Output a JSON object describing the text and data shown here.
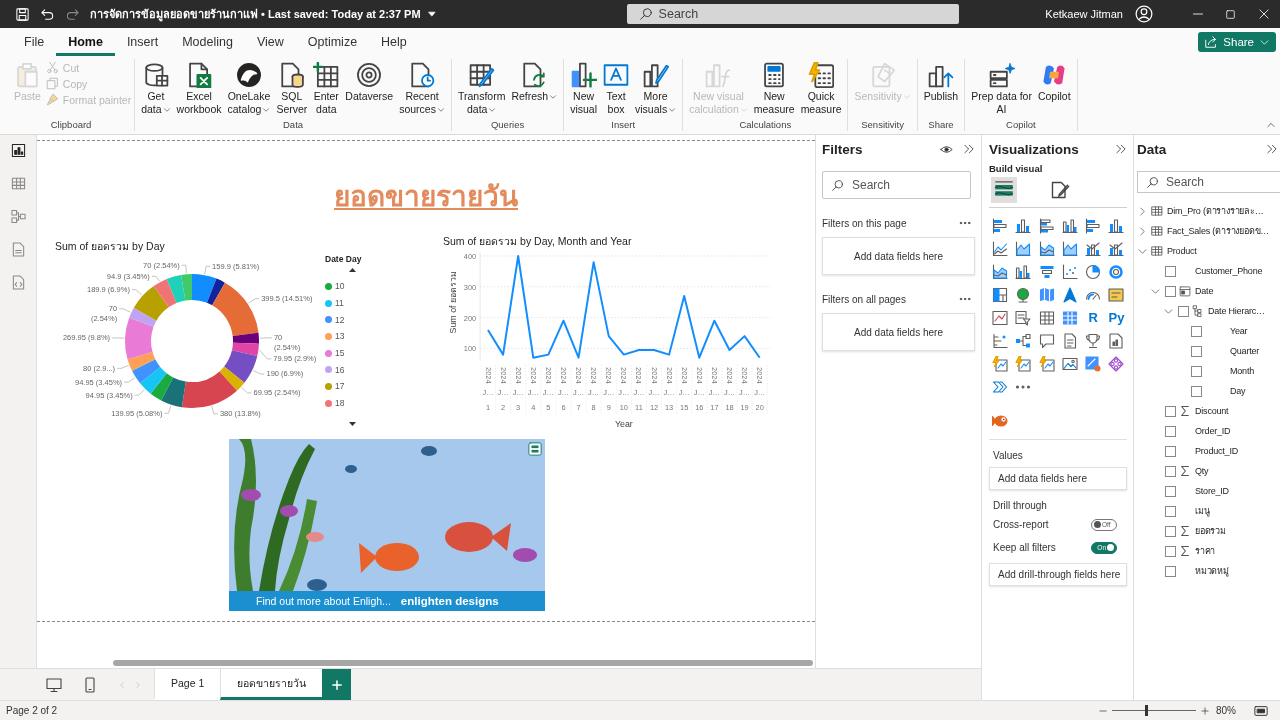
{
  "titlebar": {
    "title": "การจัดการข้อมูลยอดขายร้านกาแฟ • Last saved: Today at 2:37 PM",
    "search_placeholder": "Search",
    "user": "Ketkaew Jitman"
  },
  "menu": [
    {
      "label": "File",
      "selected": false
    },
    {
      "label": "Home",
      "selected": true
    },
    {
      "label": "Insert",
      "selected": false
    },
    {
      "label": "Modeling",
      "selected": false
    },
    {
      "label": "View",
      "selected": false
    },
    {
      "label": "Optimize",
      "selected": false
    },
    {
      "label": "Help",
      "selected": false
    }
  ],
  "share_button": "Share",
  "ribbon": [
    {
      "label": "Clipboard",
      "buttons": [
        {
          "label": "Paste",
          "disabled": true,
          "dropdown": false
        }
      ],
      "small_buttons": [
        {
          "label": "Cut",
          "disabled": true
        },
        {
          "label": "Copy",
          "disabled": true
        },
        {
          "label": "Format painter",
          "disabled": true
        }
      ]
    },
    {
      "label": "Data",
      "buttons": [
        {
          "label": "Get\ndata",
          "disabled": false,
          "dropdown": true
        },
        {
          "label": "Excel\nworkbook",
          "disabled": false,
          "dropdown": false
        },
        {
          "label": "OneLake\ncatalog",
          "disabled": false,
          "dropdown": true
        },
        {
          "label": "SQL\nServer",
          "disabled": false,
          "dropdown": false
        },
        {
          "label": "Enter\ndata",
          "disabled": false,
          "dropdown": false
        },
        {
          "label": "Dataverse",
          "disabled": false,
          "dropdown": false
        },
        {
          "label": "Recent\nsources",
          "disabled": false,
          "dropdown": true
        }
      ]
    },
    {
      "label": "Queries",
      "buttons": [
        {
          "label": "Transform\ndata",
          "disabled": false,
          "dropdown": true
        },
        {
          "label": "Refresh",
          "disabled": false,
          "dropdown": true
        }
      ]
    },
    {
      "label": "Insert",
      "buttons": [
        {
          "label": "New\nvisual",
          "disabled": false,
          "dropdown": false
        },
        {
          "label": "Text\nbox",
          "disabled": false,
          "dropdown": false
        },
        {
          "label": "More\nvisuals",
          "disabled": false,
          "dropdown": true
        }
      ]
    },
    {
      "label": "Calculations",
      "buttons": [
        {
          "label": "New visual\ncalculation",
          "disabled": true,
          "dropdown": true
        },
        {
          "label": "New\nmeasure",
          "disabled": false,
          "dropdown": false
        },
        {
          "label": "Quick\nmeasure",
          "disabled": false,
          "dropdown": false
        }
      ]
    },
    {
      "label": "Sensitivity",
      "buttons": [
        {
          "label": "Sensitivity",
          "disabled": true,
          "dropdown": true
        }
      ]
    },
    {
      "label": "Share",
      "buttons": [
        {
          "label": "Publish",
          "disabled": false,
          "dropdown": false
        }
      ]
    },
    {
      "label": "Copilot",
      "buttons": [
        {
          "label": "Prep data for\nAI",
          "disabled": false,
          "dropdown": false
        },
        {
          "label": "Copilot",
          "disabled": false,
          "dropdown": false
        }
      ]
    }
  ],
  "view_rail": [
    {
      "selected": true
    },
    {
      "selected": false
    },
    {
      "selected": false
    },
    {
      "selected": false
    },
    {
      "selected": false
    }
  ],
  "report": {
    "title": "ยอดขายรายวัน",
    "donut": {
      "chart_data": {
        "type": "donut",
        "title": "Sum of ยอดรวม by Day",
        "values": [
          159.9,
          60,
          399.5,
          70,
          79.95,
          190,
          69.95,
          380,
          139.95,
          80,
          94.95,
          94.95,
          80,
          269.95,
          70,
          189.9,
          94.9,
          95,
          70
        ],
        "colors": [
          "#118dff",
          "#12239e",
          "#e66c37",
          "#6b007b",
          "#e044a7",
          "#744ec2",
          "#d9b300",
          "#d64550",
          "#197278",
          "#1aab40",
          "#15c6f4",
          "#4092ff",
          "#ffa058",
          "#e97ad6",
          "#c0a4f3",
          "#b8a000",
          "#f07475",
          "#1fd1b8",
          "#41c96a"
        ],
        "value_labels": [
          "159.9 (5.81%)",
          null,
          "399.5 (14.51%)",
          "70\n(2.54%)",
          "79.95 (2.9%)",
          "190 (6.9%)",
          "69.95 (2.54%)",
          "380 (13.8%)",
          "139.95 (5.08%)",
          null,
          "94.95 (3.45%)",
          "94.95 (3.45%)",
          "80 (2.9...)",
          "269.95 (9.8%)",
          "70\n(2.54%)",
          "189.9 (6.9%)",
          "94.9 (3.45%)",
          null,
          "70 (2.54%)"
        ]
      }
    },
    "legend": {
      "title": "Date Day",
      "items": [
        {
          "label": "10",
          "color": "#1aab40"
        },
        {
          "label": "11",
          "color": "#15c6f4"
        },
        {
          "label": "12",
          "color": "#4092ff"
        },
        {
          "label": "13",
          "color": "#ffa058"
        },
        {
          "label": "15",
          "color": "#e97ad6"
        },
        {
          "label": "16",
          "color": "#c0a4f3"
        },
        {
          "label": "17",
          "color": "#b8a000"
        },
        {
          "label": "18",
          "color": "#f07475"
        }
      ]
    },
    "line": {
      "chart_data": {
        "type": "line",
        "title": "Sum of ยอดรวม by Day, Month and Year",
        "xlabel": "Year",
        "ylabel": "Sum of ยอดรวม",
        "categories": [
          "2024 J… 1",
          "2024 J… 2",
          "2024 J… 3",
          "2024 J… 4",
          "2024 J… 5",
          "2024 J… 6",
          "2024 J… 7",
          "2024 J… 8",
          "2024 J… 9",
          "2024 J… 10",
          "2024 J… 11",
          "2024 J… 12",
          "2024 J… 13",
          "2024 J… 15",
          "2024 J… 16",
          "2024 J… 17",
          "2024 J… 18",
          "2024 J… 19",
          "2024 J… 20"
        ],
        "series": [
          {
            "color": "#118dff",
            "values": [
              160,
              80,
              400,
              70,
              80,
              190,
              70,
              380,
              140,
              80,
              95,
              95,
              80,
              270,
              70,
              190,
              95,
              140,
              70
            ]
          }
        ],
        "ylim": [
          60,
          410
        ],
        "yticks": [
          100,
          200,
          300,
          400
        ],
        "grid": true
      }
    },
    "aquarium": {
      "caption": "Find out more about Enligh...",
      "brand": "enlighten designs"
    }
  },
  "filters": {
    "title": "Filters",
    "search_placeholder": "Search",
    "sections": [
      {
        "label": "Filters on this page",
        "placeholder": "Add data fields here"
      },
      {
        "label": "Filters on all pages",
        "placeholder": "Add data fields here"
      }
    ]
  },
  "visualizations": {
    "title": "Visualizations",
    "subtitle": "Build visual",
    "build_tabs": [
      {
        "selected": true
      },
      {
        "selected": false
      }
    ],
    "script_visuals": [
      "R",
      "Py"
    ],
    "values_label": "Values",
    "values_placeholder": "Add data fields here",
    "drill_label": "Drill through",
    "toggles": [
      {
        "label": "Cross-report",
        "on": false,
        "text": "Off"
      },
      {
        "label": "Keep all filters",
        "on": true,
        "text": "On"
      }
    ],
    "drill_placeholder": "Add drill-through fields here"
  },
  "data": {
    "title": "Data",
    "search_placeholder": "Search",
    "tree": [
      {
        "label": "Dim_Pro (ตารางรายละ…",
        "kind": "table",
        "expanded": false
      },
      {
        "label": "Fact_Sales (ตารางยอดข…",
        "kind": "table",
        "expanded": false
      },
      {
        "label": "Product",
        "kind": "table",
        "expanded": true,
        "children": [
          {
            "label": "Customer_Phone",
            "kind": "text",
            "checked": false
          },
          {
            "label": "Date",
            "kind": "date",
            "checked": false,
            "expanded": true,
            "children": [
              {
                "label": "Date Hierarc…",
                "kind": "hierarchy",
                "checked": false,
                "expanded": true,
                "children": [
                  {
                    "label": "Year",
                    "kind": "level",
                    "checked": false
                  },
                  {
                    "label": "Quarter",
                    "kind": "level",
                    "checked": false
                  },
                  {
                    "label": "Month",
                    "kind": "level",
                    "checked": false
                  },
                  {
                    "label": "Day",
                    "kind": "level",
                    "checked": false
                  }
                ]
              }
            ]
          },
          {
            "label": "Discount",
            "kind": "numeric",
            "checked": false
          },
          {
            "label": "Order_ID",
            "kind": "text",
            "checked": false
          },
          {
            "label": "Product_ID",
            "kind": "text",
            "checked": false
          },
          {
            "label": "Qty",
            "kind": "numeric",
            "checked": false
          },
          {
            "label": "Store_ID",
            "kind": "text",
            "checked": false
          },
          {
            "label": "เมนู",
            "kind": "text",
            "checked": false
          },
          {
            "label": "ยอดรวม",
            "kind": "numeric",
            "checked": false
          },
          {
            "label": "ราคา",
            "kind": "numeric",
            "checked": false
          },
          {
            "label": "หมวดหมู่",
            "kind": "text",
            "checked": false
          }
        ]
      }
    ]
  },
  "pages": [
    {
      "label": "Page 1",
      "selected": false
    },
    {
      "label": "ยอดขายรายวัน",
      "selected": true
    }
  ],
  "status_bar": {
    "page": "Page 2 of 2",
    "zoom": {
      "level": 0.4,
      "text": "80%"
    }
  }
}
